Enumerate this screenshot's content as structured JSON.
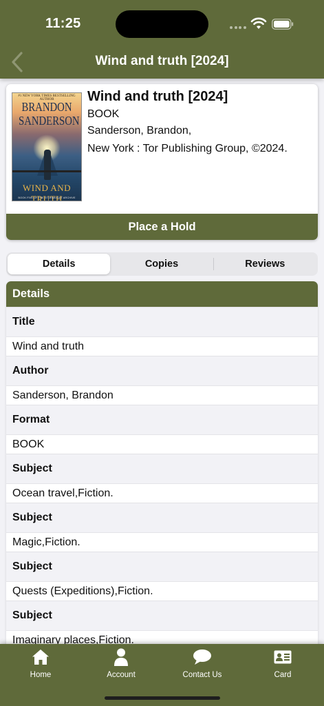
{
  "status_bar": {
    "time": "11:25"
  },
  "header": {
    "title": "Wind and truth [2024]"
  },
  "book": {
    "title": "Wind and truth [2024]",
    "format": "BOOK",
    "author": "Sanderson, Brandon,",
    "publisher": "New York : Tor Publishing Group, ©2024.",
    "cover": {
      "top_line": "#1 NEW YORK TIMES BESTSELLING AUTHOR",
      "author_line1": "BRANDON",
      "author_line2": "SANDERSON",
      "title": "WIND AND TRUTH",
      "subtitle": "BOOK FIVE OF THE STORMLIGHT ARCHIVE"
    },
    "hold_label": "Place a Hold"
  },
  "tabs": [
    "Details",
    "Copies",
    "Reviews"
  ],
  "details": {
    "heading": "Details",
    "rows": [
      {
        "label": "Title",
        "value": "Wind and truth"
      },
      {
        "label": "Author",
        "value": "Sanderson, Brandon"
      },
      {
        "label": "Format",
        "value": "BOOK"
      },
      {
        "label": "Subject",
        "value": "Ocean travel,Fiction."
      },
      {
        "label": "Subject",
        "value": "Magic,Fiction."
      },
      {
        "label": "Subject",
        "value": "Quests (Expeditions),Fiction."
      },
      {
        "label": "Subject",
        "value": "Imaginary places,Fiction."
      }
    ]
  },
  "tabbar": {
    "home": "Home",
    "account": "Account",
    "contact": "Contact Us",
    "card": "Card"
  },
  "colors": {
    "brand": "#5f6a3a",
    "background": "#f2f2f6"
  }
}
